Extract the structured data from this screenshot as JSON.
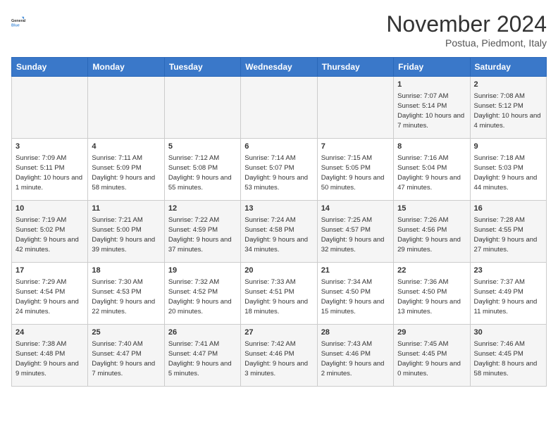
{
  "logo": {
    "line1": "General",
    "line2": "Blue"
  },
  "title": "November 2024",
  "subtitle": "Postua, Piedmont, Italy",
  "days_of_week": [
    "Sunday",
    "Monday",
    "Tuesday",
    "Wednesday",
    "Thursday",
    "Friday",
    "Saturday"
  ],
  "weeks": [
    [
      {
        "day": "",
        "info": ""
      },
      {
        "day": "",
        "info": ""
      },
      {
        "day": "",
        "info": ""
      },
      {
        "day": "",
        "info": ""
      },
      {
        "day": "",
        "info": ""
      },
      {
        "day": "1",
        "info": "Sunrise: 7:07 AM\nSunset: 5:14 PM\nDaylight: 10 hours and 7 minutes."
      },
      {
        "day": "2",
        "info": "Sunrise: 7:08 AM\nSunset: 5:12 PM\nDaylight: 10 hours and 4 minutes."
      }
    ],
    [
      {
        "day": "3",
        "info": "Sunrise: 7:09 AM\nSunset: 5:11 PM\nDaylight: 10 hours and 1 minute."
      },
      {
        "day": "4",
        "info": "Sunrise: 7:11 AM\nSunset: 5:09 PM\nDaylight: 9 hours and 58 minutes."
      },
      {
        "day": "5",
        "info": "Sunrise: 7:12 AM\nSunset: 5:08 PM\nDaylight: 9 hours and 55 minutes."
      },
      {
        "day": "6",
        "info": "Sunrise: 7:14 AM\nSunset: 5:07 PM\nDaylight: 9 hours and 53 minutes."
      },
      {
        "day": "7",
        "info": "Sunrise: 7:15 AM\nSunset: 5:05 PM\nDaylight: 9 hours and 50 minutes."
      },
      {
        "day": "8",
        "info": "Sunrise: 7:16 AM\nSunset: 5:04 PM\nDaylight: 9 hours and 47 minutes."
      },
      {
        "day": "9",
        "info": "Sunrise: 7:18 AM\nSunset: 5:03 PM\nDaylight: 9 hours and 44 minutes."
      }
    ],
    [
      {
        "day": "10",
        "info": "Sunrise: 7:19 AM\nSunset: 5:02 PM\nDaylight: 9 hours and 42 minutes."
      },
      {
        "day": "11",
        "info": "Sunrise: 7:21 AM\nSunset: 5:00 PM\nDaylight: 9 hours and 39 minutes."
      },
      {
        "day": "12",
        "info": "Sunrise: 7:22 AM\nSunset: 4:59 PM\nDaylight: 9 hours and 37 minutes."
      },
      {
        "day": "13",
        "info": "Sunrise: 7:24 AM\nSunset: 4:58 PM\nDaylight: 9 hours and 34 minutes."
      },
      {
        "day": "14",
        "info": "Sunrise: 7:25 AM\nSunset: 4:57 PM\nDaylight: 9 hours and 32 minutes."
      },
      {
        "day": "15",
        "info": "Sunrise: 7:26 AM\nSunset: 4:56 PM\nDaylight: 9 hours and 29 minutes."
      },
      {
        "day": "16",
        "info": "Sunrise: 7:28 AM\nSunset: 4:55 PM\nDaylight: 9 hours and 27 minutes."
      }
    ],
    [
      {
        "day": "17",
        "info": "Sunrise: 7:29 AM\nSunset: 4:54 PM\nDaylight: 9 hours and 24 minutes."
      },
      {
        "day": "18",
        "info": "Sunrise: 7:30 AM\nSunset: 4:53 PM\nDaylight: 9 hours and 22 minutes."
      },
      {
        "day": "19",
        "info": "Sunrise: 7:32 AM\nSunset: 4:52 PM\nDaylight: 9 hours and 20 minutes."
      },
      {
        "day": "20",
        "info": "Sunrise: 7:33 AM\nSunset: 4:51 PM\nDaylight: 9 hours and 18 minutes."
      },
      {
        "day": "21",
        "info": "Sunrise: 7:34 AM\nSunset: 4:50 PM\nDaylight: 9 hours and 15 minutes."
      },
      {
        "day": "22",
        "info": "Sunrise: 7:36 AM\nSunset: 4:50 PM\nDaylight: 9 hours and 13 minutes."
      },
      {
        "day": "23",
        "info": "Sunrise: 7:37 AM\nSunset: 4:49 PM\nDaylight: 9 hours and 11 minutes."
      }
    ],
    [
      {
        "day": "24",
        "info": "Sunrise: 7:38 AM\nSunset: 4:48 PM\nDaylight: 9 hours and 9 minutes."
      },
      {
        "day": "25",
        "info": "Sunrise: 7:40 AM\nSunset: 4:47 PM\nDaylight: 9 hours and 7 minutes."
      },
      {
        "day": "26",
        "info": "Sunrise: 7:41 AM\nSunset: 4:47 PM\nDaylight: 9 hours and 5 minutes."
      },
      {
        "day": "27",
        "info": "Sunrise: 7:42 AM\nSunset: 4:46 PM\nDaylight: 9 hours and 3 minutes."
      },
      {
        "day": "28",
        "info": "Sunrise: 7:43 AM\nSunset: 4:46 PM\nDaylight: 9 hours and 2 minutes."
      },
      {
        "day": "29",
        "info": "Sunrise: 7:45 AM\nSunset: 4:45 PM\nDaylight: 9 hours and 0 minutes."
      },
      {
        "day": "30",
        "info": "Sunrise: 7:46 AM\nSunset: 4:45 PM\nDaylight: 8 hours and 58 minutes."
      }
    ]
  ]
}
